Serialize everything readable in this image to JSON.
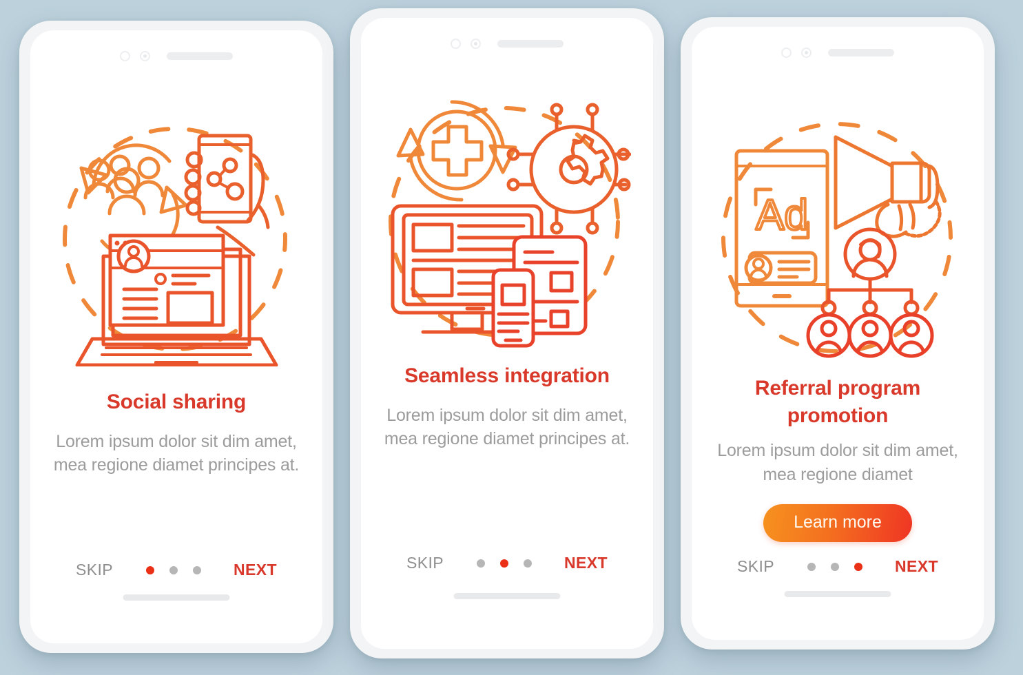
{
  "background_color": "#bcd1dc",
  "accent": {
    "title_red": "#d9392a",
    "dot_active": "#ea3118",
    "dot_inactive": "#b6b6b6",
    "body_gray": "#9c9c9c",
    "skip_gray": "#8e8e8e",
    "cta_gradient_from": "#f6921f",
    "cta_gradient_to": "#ef3524",
    "illustration_orange": "#f08a32",
    "illustration_red": "#e8462a"
  },
  "screens": [
    {
      "id": "social-sharing",
      "illustration_name": "social-sharing-illustration",
      "title": "Social sharing",
      "description": "Lorem ipsum dolor sit dim amet, mea regione diamet principes at.",
      "cta": null,
      "skip_label": "SKIP",
      "next_label": "NEXT",
      "dots": 3,
      "active_dot": 0
    },
    {
      "id": "seamless-integration",
      "illustration_name": "seamless-integration-illustration",
      "title": "Seamless integration",
      "description": "Lorem ipsum dolor sit dim amet, mea regione diamet principes at.",
      "cta": null,
      "skip_label": "SKIP",
      "next_label": "NEXT",
      "dots": 3,
      "active_dot": 1
    },
    {
      "id": "referral-program-promotion",
      "illustration_name": "referral-program-illustration",
      "title": "Referral program promotion",
      "description": "Lorem ipsum dolor sit dim amet, mea regione diamet",
      "cta": "Learn more",
      "skip_label": "SKIP",
      "next_label": "NEXT",
      "dots": 3,
      "active_dot": 2
    }
  ]
}
